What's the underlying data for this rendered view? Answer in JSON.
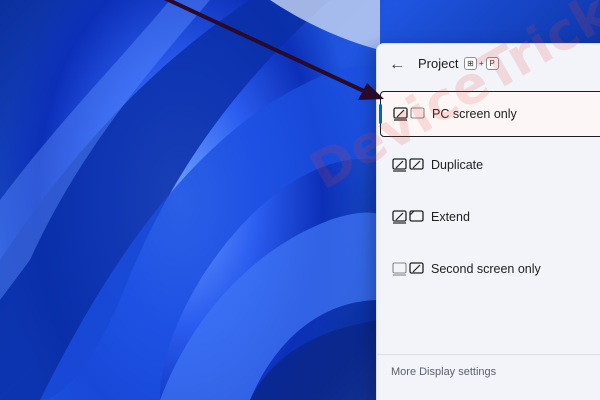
{
  "flyout": {
    "title": "Project",
    "shortcut": {
      "win_key": "⊞",
      "plus": "+",
      "letter": "P"
    },
    "back_icon": "arrow-left-icon",
    "options": [
      {
        "label": "PC screen only",
        "icon": "pc-screen-only-icon",
        "selected": true
      },
      {
        "label": "Duplicate",
        "icon": "duplicate-icon",
        "selected": false
      },
      {
        "label": "Extend",
        "icon": "extend-icon",
        "selected": false
      },
      {
        "label": "Second screen only",
        "icon": "second-screen-only-icon",
        "selected": false
      }
    ],
    "footer_link": "More Display settings"
  },
  "watermark": {
    "text": "DeviceTricks"
  },
  "colors": {
    "accent": "#0067c0",
    "annotation_arrow": "#2a0a2a",
    "wallpaper_primary": "#1f55e0",
    "flyout_bg": "#f2f4f9"
  }
}
